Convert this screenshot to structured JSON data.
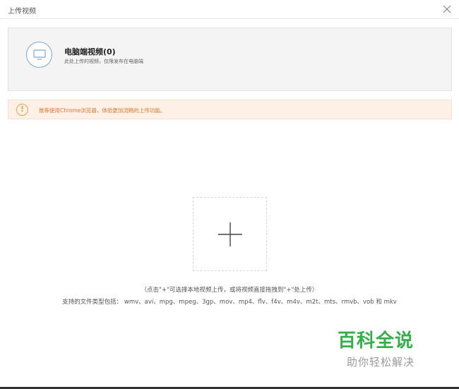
{
  "window": {
    "title": "上传视频",
    "close_icon": "close-icon"
  },
  "source_panel": {
    "icon": "monitor-icon",
    "heading": "电脑端视频(0)",
    "description": "此处上传的视频，仅限发布在电脑端",
    "accent_color": "#7aa7d6"
  },
  "warning": {
    "icon": "exclamation-icon",
    "text": "推荐使用Chrome浏览器，体验更加流畅的上传功能。",
    "text_color": "#e07a2f",
    "background_color": "#fdf0e6"
  },
  "dropzone": {
    "icon": "plus-icon"
  },
  "hints": {
    "line1": "（点击\"+\"可选择本地视频上传，或将视频直接拖拽到\"+\"处上传）",
    "line2": "支持的文件类型包括： wmv、avi、mpg、mpeg、3gp、mov、mp4、flv、f4v、m4v、m2t、mts、rmvb、vob 和 mkv"
  },
  "watermark": {
    "main": "百科全说",
    "sub": "助你轻松解决",
    "color": "#34b04a"
  }
}
